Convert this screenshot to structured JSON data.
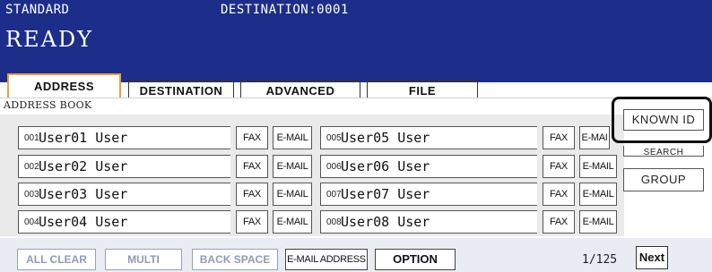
{
  "header": {
    "mode": "STANDARD",
    "destination_label": "DESTINATION:0001",
    "status": "READY"
  },
  "tabs": [
    {
      "label": "ADDRESS",
      "active": true
    },
    {
      "label": "DESTINATION",
      "active": false
    },
    {
      "label": "ADVANCED",
      "active": false
    },
    {
      "label": "FILE",
      "active": false
    }
  ],
  "section_label": "ADDRESS BOOK",
  "entries": [
    {
      "num": "001",
      "name": "User01 User",
      "fax": "FAX",
      "email": "E-MAIL"
    },
    {
      "num": "002",
      "name": "User02 User",
      "fax": "FAX",
      "email": "E-MAIL"
    },
    {
      "num": "003",
      "name": "User03 User",
      "fax": "FAX",
      "email": "E-MAIL"
    },
    {
      "num": "004",
      "name": "User04 User",
      "fax": "FAX",
      "email": "E-MAIL"
    },
    {
      "num": "005",
      "name": "User05 User",
      "fax": "FAX",
      "email": "E-MAI"
    },
    {
      "num": "006",
      "name": "User06 User",
      "fax": "FAX",
      "email": "E-MAIL"
    },
    {
      "num": "007",
      "name": "User07 User",
      "fax": "FAX",
      "email": "E-MAIL"
    },
    {
      "num": "008",
      "name": "User08 User",
      "fax": "FAX",
      "email": "E-MAIL"
    }
  ],
  "side_buttons": {
    "known_id": "KNOWN ID",
    "search_address": "SEARCH ADDRESS",
    "group": "GROUP"
  },
  "bottom": {
    "all_clear": "ALL CLEAR",
    "multi": "MULTI",
    "back_space": "BACK SPACE",
    "email_address": "E-MAIL ADDRESS",
    "option": "OPTION",
    "page": "1/125",
    "next": "Next"
  },
  "colors": {
    "header_bg": "#1c2d8a",
    "active_tab_border": "#e8a23a",
    "disabled_text": "#8d9bb5"
  }
}
